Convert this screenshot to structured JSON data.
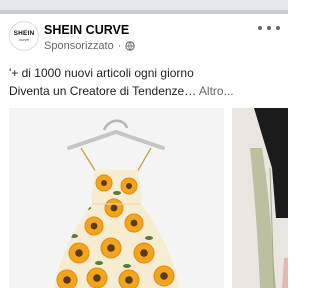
{
  "post": {
    "page_name": "SHEIN CURVE",
    "sponsored_label": "Sponsorizzato",
    "separator": "·",
    "caption_line1": "'+ di 1000 nuovi articoli ogni giorno",
    "caption_line2": "Diventa un Creatore di Tendenze…",
    "see_more": "Altro..."
  },
  "avatar": {
    "logo_main": "SHEIN",
    "logo_sub": "curve"
  },
  "icons": {
    "privacy": "globe-icon",
    "menu": "more-options-icon"
  },
  "colors": {
    "text_secondary": "#65676b",
    "dress_base": "#f6ecd2",
    "sunflower": "#f2a51c",
    "leaf": "#5b7a3a"
  }
}
